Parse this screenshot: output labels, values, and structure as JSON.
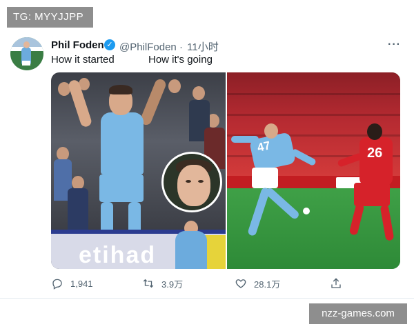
{
  "overlay": {
    "top_badge": "TG: MYYJJPP",
    "bottom_watermark": "nzz-games.com"
  },
  "tweet": {
    "author_name": "Phil Foden",
    "verified": true,
    "handle": "@PhilFoden",
    "separator": "·",
    "time": "11小时",
    "more_icon": "ellipsis-icon",
    "text_left": "How it started",
    "text_right": "How it's going",
    "images": [
      {
        "description_icon": "photo-city-player-celebrating-icon",
        "left_shirt_color": "#7ab8e5"
      },
      {
        "description_icon": "photo-city-vs-liverpool-action-icon",
        "right_shirt_numbers": [
          "47",
          "26"
        ]
      }
    ]
  },
  "actions": {
    "reply_count": "1,941",
    "retweet_count": "3.9万",
    "like_count": "28.1万",
    "icons": [
      "reply-icon",
      "retweet-icon",
      "like-icon",
      "share-icon"
    ]
  },
  "colors": {
    "verified_blue": "#1d9bf0",
    "secondary_text": "#536471",
    "overlay_grey": "#8e8e8e"
  }
}
